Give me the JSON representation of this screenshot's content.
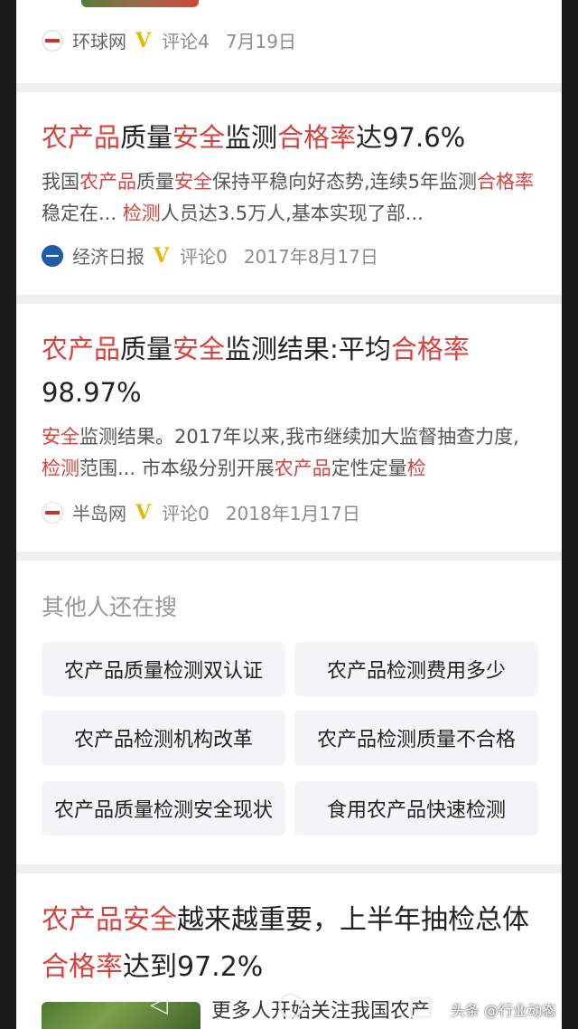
{
  "articles": [
    {
      "source": "环球网",
      "verified": "V",
      "comments": "评论4",
      "date": "7月19日"
    },
    {
      "title": [
        {
          "t": "农产品",
          "h": true
        },
        {
          "t": "质量",
          "h": false
        },
        {
          "t": "安全",
          "h": true
        },
        {
          "t": "监测",
          "h": false
        },
        {
          "t": "合格率",
          "h": true
        },
        {
          "t": "达97.6%",
          "h": false
        }
      ],
      "summary": [
        {
          "t": "我国",
          "h": false
        },
        {
          "t": "农产品",
          "h": true
        },
        {
          "t": "质量",
          "h": false
        },
        {
          "t": "安全",
          "h": true
        },
        {
          "t": "保持平稳向好态势,连续5年监测",
          "h": false
        },
        {
          "t": "合格率",
          "h": true
        },
        {
          "t": "稳定在... ",
          "h": false
        },
        {
          "t": "检测",
          "h": true
        },
        {
          "t": "人员达3.5万人,基本实现了部...",
          "h": false
        }
      ],
      "source": "经济日报",
      "verified": "V",
      "comments": "评论0",
      "date": "2017年8月17日"
    },
    {
      "title": [
        {
          "t": "农产品",
          "h": true
        },
        {
          "t": "质量",
          "h": false
        },
        {
          "t": "安全",
          "h": true
        },
        {
          "t": "监测结果:平均",
          "h": false
        },
        {
          "t": "合格率",
          "h": true
        },
        {
          "t": "98.97%",
          "h": false
        }
      ],
      "summary": [
        {
          "t": "安全",
          "h": true
        },
        {
          "t": "监测结果。2017年以来,我市继续加大监督抽查力度,",
          "h": false
        },
        {
          "t": "检测",
          "h": true
        },
        {
          "t": "范围... 市本级分别开展",
          "h": false
        },
        {
          "t": "农产品",
          "h": true
        },
        {
          "t": "定性定量",
          "h": false
        },
        {
          "t": "检",
          "h": true
        }
      ],
      "source": "半岛网",
      "verified": "V",
      "comments": "评论0",
      "date": "2018年1月17日"
    }
  ],
  "related": {
    "title": "其他人还在搜",
    "items": [
      "农产品质量检测双认证",
      "农产品检测费用多少",
      "农产品检测机构改革",
      "农产品检测质量不合格",
      "农产品质量检测安全现状",
      "食用农产品快速检测"
    ]
  },
  "next_article": {
    "title": [
      {
        "t": "农产品安全",
        "h": true
      },
      {
        "t": "越来越重要，上半年抽检总体",
        "h": false
      },
      {
        "t": "合格率",
        "h": true
      },
      {
        "t": "达到97.2%",
        "h": false
      }
    ],
    "snippet": "更多人开始关注我国农产"
  },
  "watermark": "头条 @行业动态"
}
